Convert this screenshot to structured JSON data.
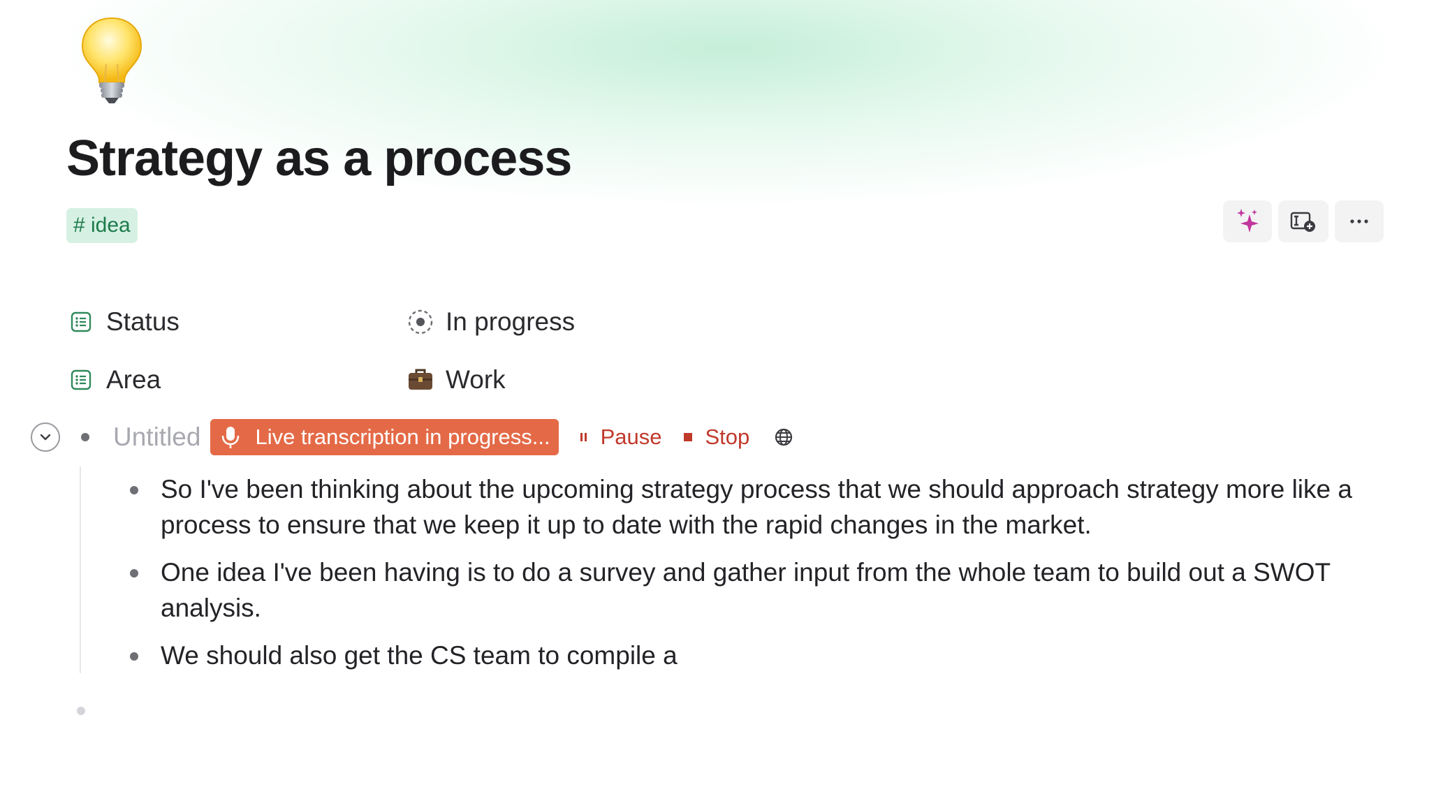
{
  "page": {
    "icon": "lightbulb-icon",
    "title": "Strategy as a process",
    "tag": "# idea"
  },
  "toolbar": {
    "buttons": [
      {
        "icon": "sparkles-icon",
        "color": "#c2379e"
      },
      {
        "icon": "insert-field-icon"
      },
      {
        "icon": "more-icon"
      }
    ]
  },
  "properties": [
    {
      "label": "Status",
      "icon": "list-icon",
      "value": "In progress",
      "value_icon": "in-progress-circle-icon"
    },
    {
      "label": "Area",
      "icon": "list-icon",
      "value": "Work",
      "value_icon": "briefcase-icon"
    }
  ],
  "recording": {
    "block_title": "Untitled",
    "live_label": "Live transcription in progress...",
    "pause_label": "Pause",
    "stop_label": "Stop",
    "accent": "#e46a47",
    "action_color": "#c0392b"
  },
  "notes": [
    "So I've been thinking about the upcoming strategy process that we should approach strategy more like a process to ensure that we keep it up to date with the rapid changes in the market.",
    " One idea I've been having is to do a survey and gather input from the whole team to build out a SWOT analysis.",
    " We should also get the CS team to compile a"
  ],
  "colors": {
    "tag_bg": "#d6f1e3",
    "tag_text": "#1e7a4c",
    "property_icon": "#2f8a5c"
  }
}
